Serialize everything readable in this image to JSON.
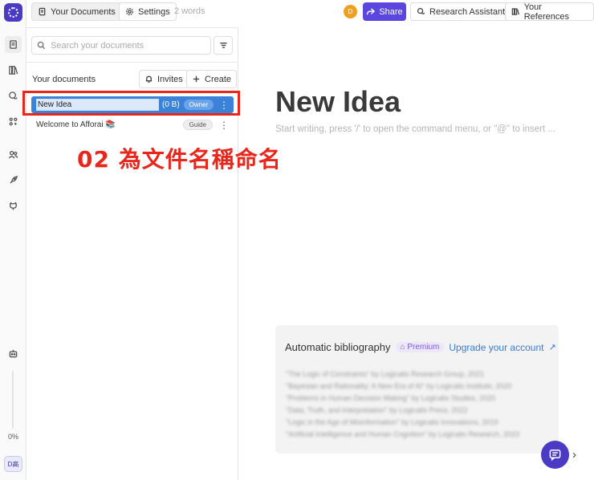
{
  "topbar": {
    "your_documents": "Your Documents",
    "settings": "Settings",
    "word_count": "2 words",
    "user_initial": "D",
    "share": "Share",
    "research_assistant": "Research Assistant",
    "your_references": "Your References"
  },
  "sidebar": {
    "progress_label": "0%",
    "avatar_label": "D高"
  },
  "panel": {
    "search_placeholder": "Search your documents",
    "section_title": "Your documents",
    "invites": "Invites",
    "create": "Create",
    "documents": [
      {
        "title": "New Idea",
        "size": "(0 B)",
        "role": "Owner"
      },
      {
        "title": "Welcome to Afforai 📚",
        "role": "Guide"
      }
    ]
  },
  "annotation": "02 為文件名稱命名",
  "editor": {
    "heading": "New Idea",
    "placeholder": "Start writing, press '/' to open the command menu, or \"@\" to insert ..."
  },
  "bibliography": {
    "title": "Automatic bibliography",
    "badge": "Premium",
    "upgrade": "Upgrade your account",
    "arrow": "↗",
    "entries": [
      "\"The Logic of Constraints\" by Logicalis Research Group, 2021",
      "\"Bayesian and Rationality: A New Era of AI\" by Logicalis Institute, 2020",
      "\"Problems in Human Decision Making\" by Logicalis Studies, 2020",
      "\"Data, Truth, and Interpretation\" by Logicalis Press, 2022",
      "\"Logic in the Age of Misinformation\" by Logicalis Innovations, 2019",
      "\"Artificial Intelligence and Human Cognition\" by Logicalis Research, 2023"
    ]
  },
  "icons": {
    "help_chevron": "›"
  },
  "colors": {
    "brand": "#4b3bc4",
    "share_button": "#5b47e0",
    "selected_row": "#3b82d9",
    "annotation": "#e8261c",
    "link": "#3a7bd5"
  }
}
